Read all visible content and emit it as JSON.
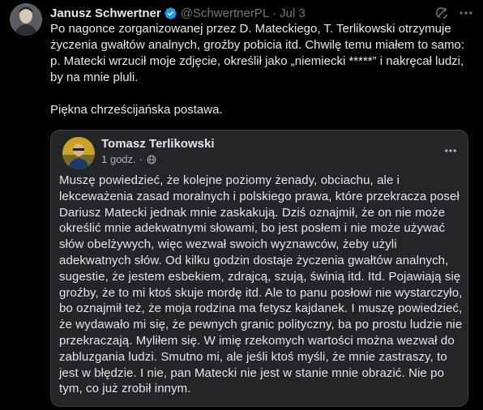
{
  "tweet": {
    "author_name": "Janusz Schwertner",
    "handle": "@SchwertnerPL",
    "separator": "·",
    "date": "Jul 3",
    "paragraphs": [
      "Po nagonce zorganizowanej przez D. Mateckiego, T. Terlikowski otrzymuje życzenia gwałtów analnych, groźby pobicia itd. Chwilę temu miałem to samo: p. Matecki wrzucił moje zdjęcie, określił jako „niemiecki *****” i nakręcał ludzi, by na mnie pluli.",
      "Piękna chrześcijańska postawa."
    ]
  },
  "quoted_post": {
    "author_name": "Tomasz Terlikowski",
    "time": "1 godz.",
    "separator": "·",
    "body": "Muszę powiedzieć, że kolejne poziomy żenady, obciachu, ale i lekceważenia zasad moralnych i polskiego prawa, które przekracza poseł Dariusz Matecki jednak mnie zaskakują. Dziś oznajmił, że on nie może określić mnie adekwatnymi słowami, bo jest posłem i nie może używać słów obelżywych, więc wezwał swoich wyznawców, żeby użyli adekwatnych słów. Od kilku godzin dostaje życzenia gwałtów analnych, sugestie, że jestem esbekiem, zdrajcą, szują, świnią itd. Itd. Pojawiają się groźby, że to mi ktoś skuje mordę itd. Ale to panu posłowi nie wystarczyło, bo oznajmił też, że moja rodzina ma fetysz kajdanek. I muszę powiedzieć, że wydawało mi się, że pewnych granic polityczny, ba po prostu ludzie nie przekraczają. Myliłem się. W imię rzekomych wartości można wezwał do zabluzgania ludzi. Smutno mi, ale jeśli ktoś myśli, że mnie zastraszy, to jest w błędzie. I nie, pan Matecki nie jest w stanie mnie obrazić. Nie po tym, co już zrobił innym."
  },
  "icons": {
    "verified": "verified-badge-icon",
    "grok": "grok-icon",
    "more": "more-icon",
    "globe": "globe-icon"
  },
  "colors": {
    "background": "#000000",
    "text": "#e7e9ea",
    "muted": "#71767b",
    "verified_blue": "#1d9bf0",
    "card_background": "#242526"
  }
}
